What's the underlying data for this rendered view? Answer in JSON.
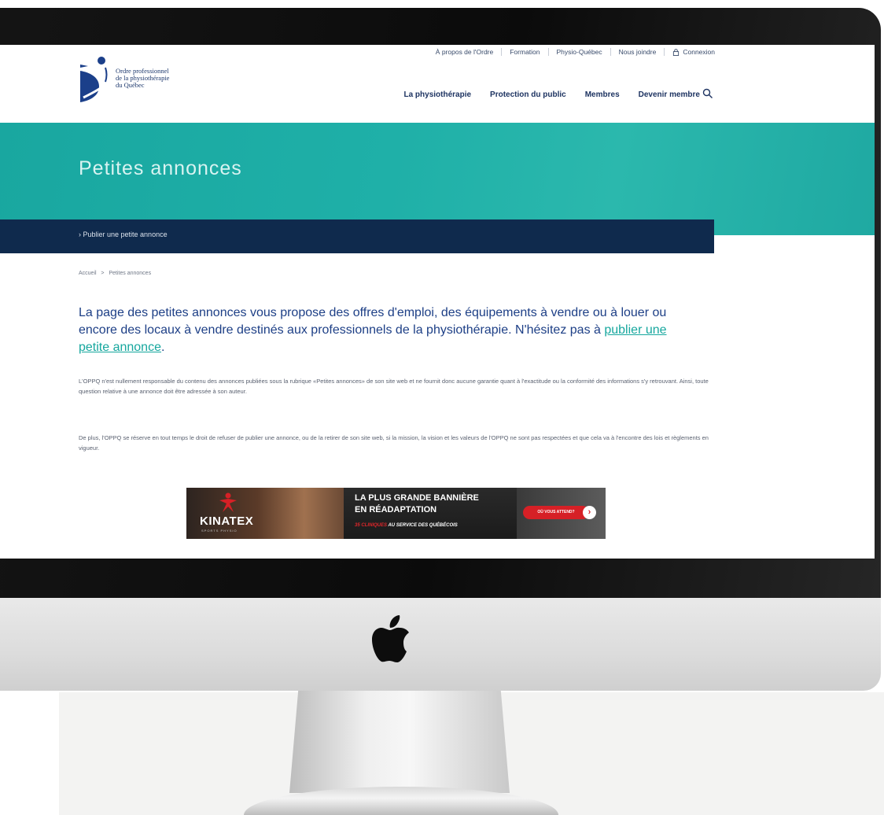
{
  "colors": {
    "teal": "#1fb0a8",
    "navy": "#0f2a4d",
    "heading_blue": "#1d3f86",
    "link_teal": "#16a79e"
  },
  "site": {
    "logo_lines": [
      "Ordre professionnel",
      "de la physiothérapie",
      "du Québec"
    ]
  },
  "top_links": [
    {
      "label": "À propos de l'Ordre"
    },
    {
      "label": "Formation"
    },
    {
      "label": "Physio-Québec"
    },
    {
      "label": "Nous joindre"
    },
    {
      "label": "Connexion",
      "icon": "lock-icon"
    }
  ],
  "main_nav": [
    {
      "label": "La physiothérapie"
    },
    {
      "label": "Protection du public"
    },
    {
      "label": "Membres"
    },
    {
      "label": "Devenir membre"
    }
  ],
  "search": {
    "icon": "search-icon"
  },
  "hero": {
    "title": "Petites annonces"
  },
  "subnav": {
    "label": "Publier une petite annonce"
  },
  "breadcrumb": [
    "Accueil",
    "Petites annonces"
  ],
  "intro": {
    "text_before": "La page des petites annonces vous propose des offres d'emploi, des équipements à vendre ou à louer ou encore des locaux à vendre destinés aux professionnels de la physiothérapie. N'hésitez pas à ",
    "link": "publier une petite annonce",
    "text_after": "."
  },
  "paragraphs": [
    "L'OPPQ n'est nullement responsable du contenu des annonces publiées sous la rubrique «Petites annonces» de son site web et ne fournit donc aucune garantie quant à l'exactitude ou la conformité des informations s'y retrouvant. Ainsi, toute question relative à une annonce doit être adressée à son auteur.",
    "De plus, l'OPPQ se réserve en tout temps le droit de refuser de publier une annonce, ou de la retirer de son site web, si la mission, la vision et les valeurs de l'OPPQ ne sont pas respectées et que cela va à l'encontre des lois et règlements en vigueur."
  ],
  "banner": {
    "brand": "KINATEX",
    "brand_tag": "SPORTS PHYSIO",
    "headline_1": "LA PLUS GRANDE BANNIÈRE",
    "headline_2": "EN RÉADAPTATION",
    "sub_red": "35 CLINIQUES",
    "sub_white": " AU SERVICE DES QUÉBÉCOIS",
    "cta": "OÙ VOUS ATTEND?"
  }
}
